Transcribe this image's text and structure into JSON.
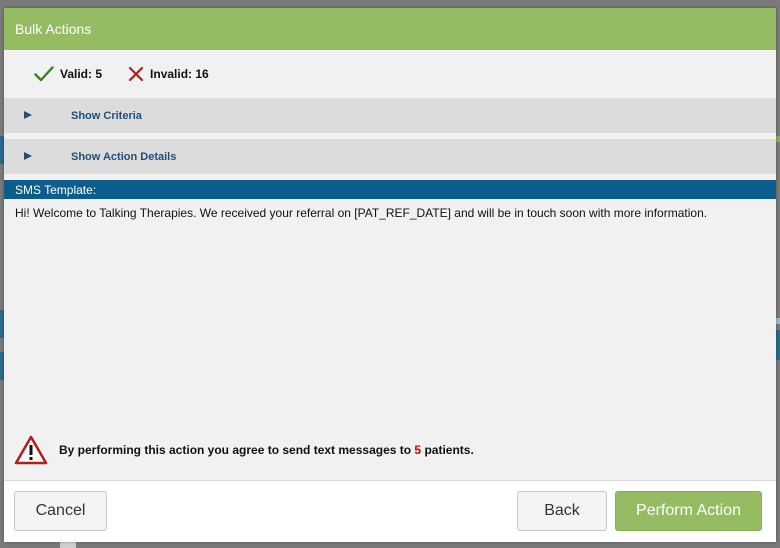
{
  "dialog": {
    "title": "Bulk Actions"
  },
  "counts": {
    "valid_label": "Valid: 5",
    "invalid_label": "Invalid: 16",
    "valid_color": "#3a7d1e",
    "invalid_color": "#b01e1e"
  },
  "sections": {
    "criteria_label": "Show Criteria",
    "details_label": "Show Action Details"
  },
  "sms": {
    "header": "SMS Template:",
    "body": "Hi! Welcome to Talking Therapies. We received your referral on [PAT_REF_DATE] and will be in touch soon with more information."
  },
  "warning": {
    "prefix": "By performing this action you agree to send text messages to ",
    "count": "5",
    "suffix": " patients."
  },
  "footer": {
    "cancel_label": "Cancel",
    "back_label": "Back",
    "perform_label": "Perform Action"
  },
  "colors": {
    "accent_green": "#95bc62",
    "header_blue": "#0d5d8c",
    "link_blue": "#1f4f78",
    "warning_red": "#cc0000"
  }
}
